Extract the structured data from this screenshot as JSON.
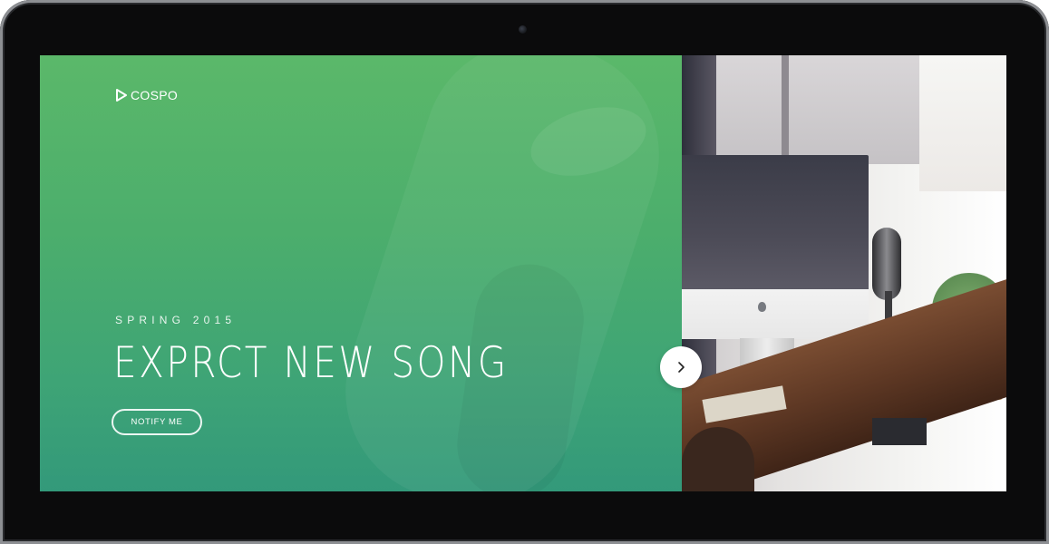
{
  "brand": {
    "name": "COSPO",
    "icon": "play-triangle-icon"
  },
  "hero": {
    "kicker": "SPRING 2015",
    "headline": "EXPRCT NEW SONG",
    "cta_label": "NOTIFY ME"
  },
  "slider": {
    "next_icon": "chevron-right-icon"
  },
  "colors": {
    "hero_top": "#5bb86a",
    "hero_bottom": "#33997a",
    "bezel": "#0b0b0c",
    "text": "#ffffff"
  }
}
